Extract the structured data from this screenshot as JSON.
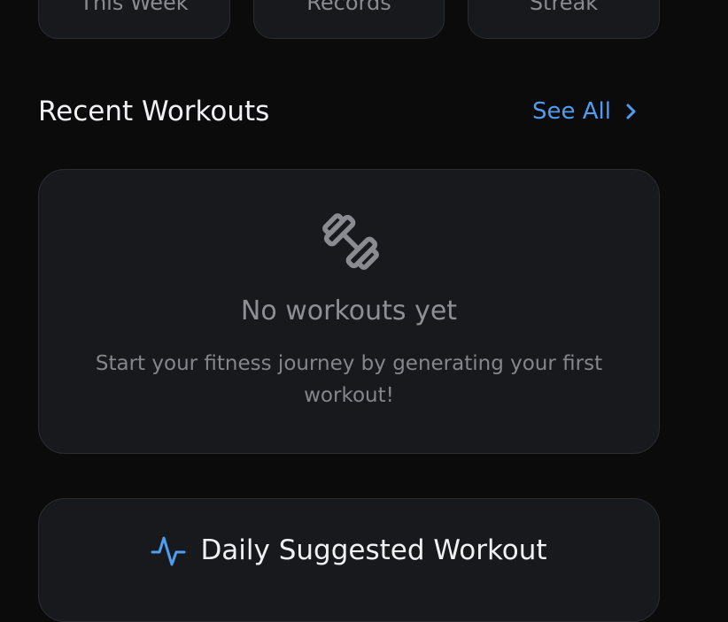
{
  "stats": {
    "this_week_label": "This Week",
    "records_label": "Records",
    "streak_label": "Streak"
  },
  "recent": {
    "title": "Recent Workouts",
    "see_all_label": "See All",
    "empty_title": "No workouts yet",
    "empty_desc": "Start your fitness journey by generating your first workout!"
  },
  "daily": {
    "title": "Daily Suggested Workout"
  },
  "icons": {
    "see_all": "chevron-right-icon",
    "empty_state": "dumbbell-icon",
    "daily": "activity-pulse-icon"
  },
  "colors": {
    "background": "#0b0b0c",
    "card": "#18191c",
    "card_border": "#2b2c30",
    "accent": "#4f9df0",
    "text_primary": "#f1f1f3",
    "text_muted": "#8e8f94"
  }
}
